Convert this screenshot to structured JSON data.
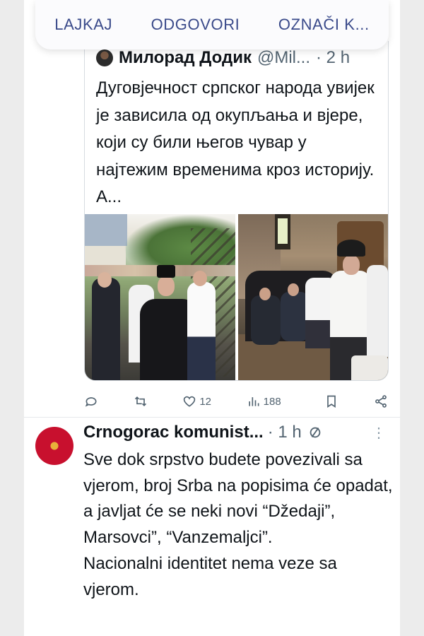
{
  "context_menu": {
    "items": [
      "LAJKAJ",
      "ODGOVORI",
      "OZNAČI K..."
    ]
  },
  "quoted_tweet": {
    "author_name": "Милорад Додик",
    "handle": "@Mil...",
    "time": "· 2 h",
    "text": "Дуговјечност српског народа увијек је зависила од окупљања и вјере, који су били његов чувар у најтежим временима кроз историју. А..."
  },
  "actions": {
    "likes": "12",
    "views": "188"
  },
  "reply": {
    "author_name": "Crnogorac komunist...",
    "time": "· 1 h",
    "text": "Sve dok srpstvo budete povezivali sa vjerom, broj Srba na popisima će opadat, a javljat će se neki novi “Džedaji”, Marsovci”, “Vanzemaljci”.\nNacionalni identitet nema veze sa vjerom."
  },
  "colors": {
    "menu_text": "#3a4a8a",
    "secondary_text": "#536471",
    "reply_avatar": "#c8102e"
  }
}
